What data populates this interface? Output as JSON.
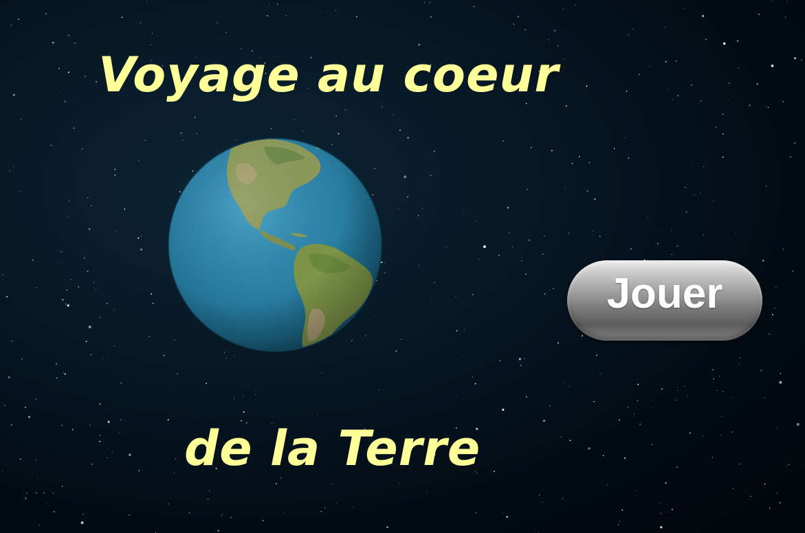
{
  "title": {
    "line1": "Voyage au coeur",
    "line2": "de la Terre"
  },
  "play_button": {
    "label": "Jouer"
  },
  "colors": {
    "title_text": "#ffff99",
    "button_text": "#ffffff",
    "space_background": "#030d16",
    "ocean": "#2a7fa3",
    "land": "#8a9a55"
  },
  "scene": {
    "background": "starfield",
    "planet": "earth-americas"
  }
}
